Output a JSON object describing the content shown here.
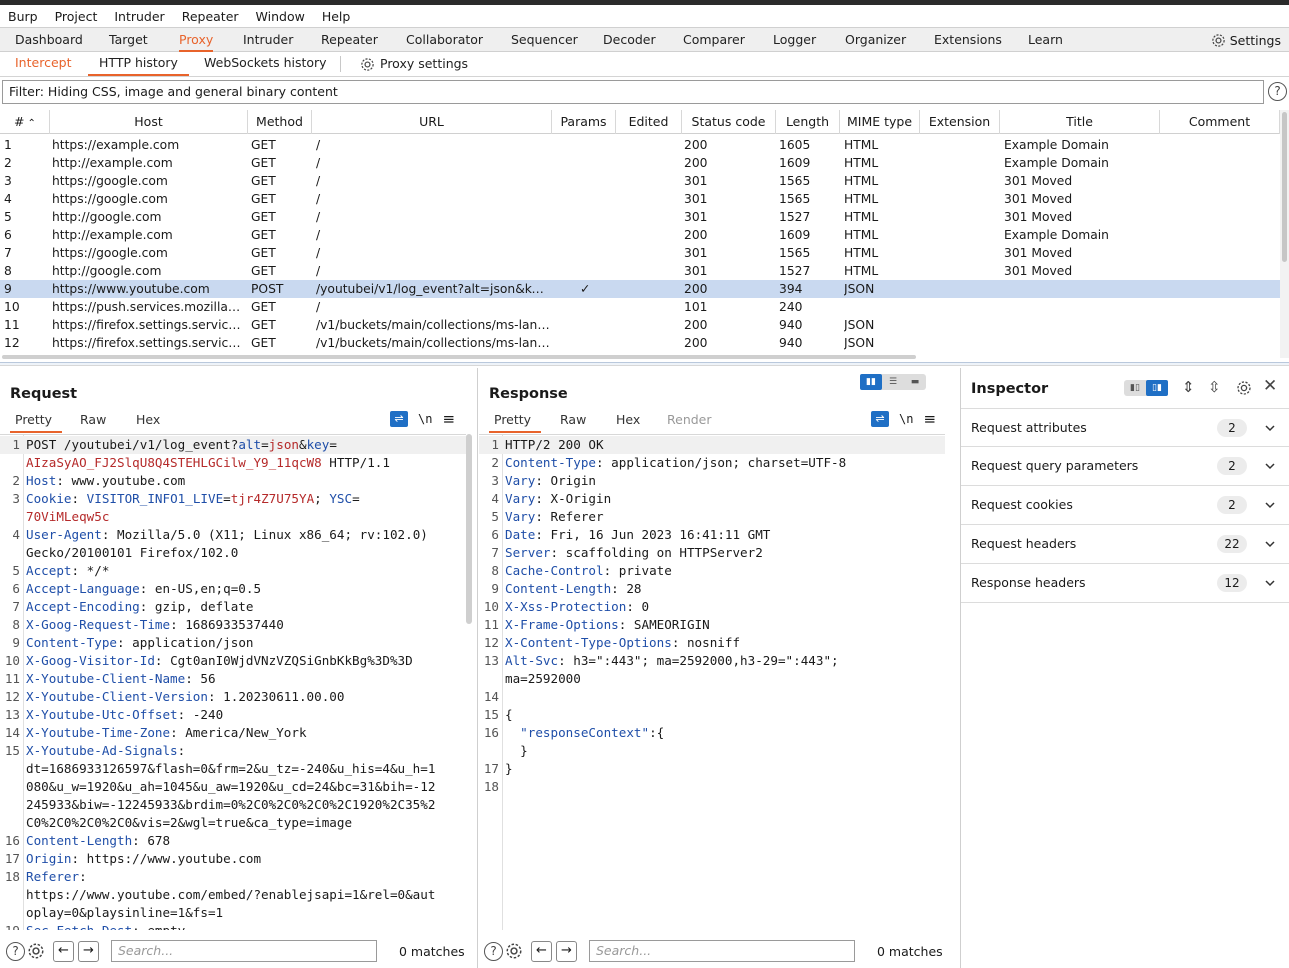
{
  "menu": [
    "Burp",
    "Project",
    "Intruder",
    "Repeater",
    "Window",
    "Help"
  ],
  "main_tabs": [
    "Dashboard",
    "Target",
    "Proxy",
    "Intruder",
    "Repeater",
    "Collaborator",
    "Sequencer",
    "Decoder",
    "Comparer",
    "Logger",
    "Organizer",
    "Extensions",
    "Learn"
  ],
  "main_tab_active": "Proxy",
  "settings_label": "Settings",
  "sub_tabs": {
    "intercept": "Intercept",
    "http_history": "HTTP history",
    "websockets": "WebSockets history",
    "proxy_settings": "Proxy settings"
  },
  "filter_text": "Filter: Hiding CSS, image and general binary content",
  "help_glyph": "?",
  "columns": [
    "#",
    "Host",
    "Method",
    "URL",
    "Params",
    "Edited",
    "Status code",
    "Length",
    "MIME type",
    "Extension",
    "Title",
    "Comment"
  ],
  "sort_glyph": "⌃",
  "rows": [
    {
      "id": "1",
      "host": "https://example.com",
      "method": "GET",
      "url": "/",
      "params": "",
      "status": "200",
      "length": "1605",
      "mime": "HTML",
      "title": "Example Domain"
    },
    {
      "id": "2",
      "host": "http://example.com",
      "method": "GET",
      "url": "/",
      "params": "",
      "status": "200",
      "length": "1609",
      "mime": "HTML",
      "title": "Example Domain"
    },
    {
      "id": "3",
      "host": "https://google.com",
      "method": "GET",
      "url": "/",
      "params": "",
      "status": "301",
      "length": "1565",
      "mime": "HTML",
      "title": "301 Moved"
    },
    {
      "id": "4",
      "host": "https://google.com",
      "method": "GET",
      "url": "/",
      "params": "",
      "status": "301",
      "length": "1565",
      "mime": "HTML",
      "title": "301 Moved"
    },
    {
      "id": "5",
      "host": "http://google.com",
      "method": "GET",
      "url": "/",
      "params": "",
      "status": "301",
      "length": "1527",
      "mime": "HTML",
      "title": "301 Moved"
    },
    {
      "id": "6",
      "host": "http://example.com",
      "method": "GET",
      "url": "/",
      "params": "",
      "status": "200",
      "length": "1609",
      "mime": "HTML",
      "title": "Example Domain"
    },
    {
      "id": "7",
      "host": "https://google.com",
      "method": "GET",
      "url": "/",
      "params": "",
      "status": "301",
      "length": "1565",
      "mime": "HTML",
      "title": "301 Moved"
    },
    {
      "id": "8",
      "host": "http://google.com",
      "method": "GET",
      "url": "/",
      "params": "",
      "status": "301",
      "length": "1527",
      "mime": "HTML",
      "title": "301 Moved"
    },
    {
      "id": "9",
      "host": "https://www.youtube.com",
      "method": "POST",
      "url": "/youtubei/v1/log_event?alt=json&key=...",
      "params": "✓",
      "status": "200",
      "length": "394",
      "mime": "JSON",
      "title": ""
    },
    {
      "id": "10",
      "host": "https://push.services.mozilla.com",
      "method": "GET",
      "url": "/",
      "params": "",
      "status": "101",
      "length": "240",
      "mime": "",
      "title": ""
    },
    {
      "id": "11",
      "host": "https://firefox.settings.services....",
      "method": "GET",
      "url": "/v1/buckets/main/collections/ms-langu...",
      "params": "",
      "status": "200",
      "length": "940",
      "mime": "JSON",
      "title": ""
    },
    {
      "id": "12",
      "host": "https://firefox.settings.services....",
      "method": "GET",
      "url": "/v1/buckets/main/collections/ms-langu...",
      "params": "",
      "status": "200",
      "length": "940",
      "mime": "JSON",
      "title": ""
    }
  ],
  "selected_row": "9",
  "request": {
    "title": "Request",
    "tabs": [
      "Pretty",
      "Raw",
      "Hex"
    ],
    "newline_glyph": "\\n",
    "menu_glyph": "≡",
    "lines": [
      {
        "n": "1",
        "parts": [
          [
            "",
            "POST /youtubei/v1/log_event?"
          ],
          [
            "k",
            "alt"
          ],
          [
            "",
            "="
          ],
          [
            "v",
            "json"
          ],
          [
            "",
            "&"
          ],
          [
            "k",
            "key"
          ],
          [
            "",
            "="
          ]
        ]
      },
      {
        "n": "",
        "parts": [
          [
            "v",
            "AIzaSyAO_FJ2SlqU8Q4STEHLGCilw_Y9_11qcW8"
          ],
          [
            "",
            " HTTP/1.1"
          ]
        ]
      },
      {
        "n": "2",
        "parts": [
          [
            "k",
            "Host"
          ],
          [
            "",
            ": www.youtube.com"
          ]
        ]
      },
      {
        "n": "3",
        "parts": [
          [
            "k",
            "Cookie"
          ],
          [
            "",
            ": "
          ],
          [
            "k",
            "VISITOR_INFO1_LIVE"
          ],
          [
            "",
            "="
          ],
          [
            "v",
            "tjr4Z7U75YA"
          ],
          [
            "",
            "; "
          ],
          [
            "k",
            "YSC"
          ],
          [
            "",
            "="
          ]
        ]
      },
      {
        "n": "",
        "parts": [
          [
            "v",
            "70ViMLeqw5c"
          ]
        ]
      },
      {
        "n": "4",
        "parts": [
          [
            "k",
            "User-Agent"
          ],
          [
            "",
            ": Mozilla/5.0 (X11; Linux x86_64; rv:102.0)"
          ]
        ]
      },
      {
        "n": "",
        "parts": [
          [
            "",
            "Gecko/20100101 Firefox/102.0"
          ]
        ]
      },
      {
        "n": "5",
        "parts": [
          [
            "k",
            "Accept"
          ],
          [
            "",
            ": */*"
          ]
        ]
      },
      {
        "n": "6",
        "parts": [
          [
            "k",
            "Accept-Language"
          ],
          [
            "",
            ": en-US,en;q=0.5"
          ]
        ]
      },
      {
        "n": "7",
        "parts": [
          [
            "k",
            "Accept-Encoding"
          ],
          [
            "",
            ": gzip, deflate"
          ]
        ]
      },
      {
        "n": "8",
        "parts": [
          [
            "k",
            "X-Goog-Request-Time"
          ],
          [
            "",
            ": 1686933537440"
          ]
        ]
      },
      {
        "n": "9",
        "parts": [
          [
            "k",
            "Content-Type"
          ],
          [
            "",
            ": application/json"
          ]
        ]
      },
      {
        "n": "10",
        "parts": [
          [
            "k",
            "X-Goog-Visitor-Id"
          ],
          [
            "",
            ": Cgt0anI0WjdVNzVZQSiGnbKkBg%3D%3D"
          ]
        ]
      },
      {
        "n": "11",
        "parts": [
          [
            "k",
            "X-Youtube-Client-Name"
          ],
          [
            "",
            ": 56"
          ]
        ]
      },
      {
        "n": "12",
        "parts": [
          [
            "k",
            "X-Youtube-Client-Version"
          ],
          [
            "",
            ": 1.20230611.00.00"
          ]
        ]
      },
      {
        "n": "13",
        "parts": [
          [
            "k",
            "X-Youtube-Utc-Offset"
          ],
          [
            "",
            ": -240"
          ]
        ]
      },
      {
        "n": "14",
        "parts": [
          [
            "k",
            "X-Youtube-Time-Zone"
          ],
          [
            "",
            ": America/New_York"
          ]
        ]
      },
      {
        "n": "15",
        "parts": [
          [
            "k",
            "X-Youtube-Ad-Signals"
          ],
          [
            "",
            ":"
          ]
        ]
      },
      {
        "n": "",
        "parts": [
          [
            "",
            "dt=1686933126597&flash=0&frm=2&u_tz=-240&u_his=4&u_h=1"
          ]
        ]
      },
      {
        "n": "",
        "parts": [
          [
            "",
            "080&u_w=1920&u_ah=1045&u_aw=1920&u_cd=24&bc=31&bih=-12"
          ]
        ]
      },
      {
        "n": "",
        "parts": [
          [
            "",
            "245933&biw=-12245933&brdim=0%2C0%2C0%2C0%2C1920%2C35%2"
          ]
        ]
      },
      {
        "n": "",
        "parts": [
          [
            "",
            "C0%2C0%2C0%2C0&vis=2&wgl=true&ca_type=image"
          ]
        ]
      },
      {
        "n": "16",
        "parts": [
          [
            "k",
            "Content-Length"
          ],
          [
            "",
            ": 678"
          ]
        ]
      },
      {
        "n": "17",
        "parts": [
          [
            "k",
            "Origin"
          ],
          [
            "",
            ": https://www.youtube.com"
          ]
        ]
      },
      {
        "n": "18",
        "parts": [
          [
            "k",
            "Referer"
          ],
          [
            "",
            ":"
          ]
        ]
      },
      {
        "n": "",
        "parts": [
          [
            "",
            "https://www.youtube.com/embed/?enablejsapi=1&rel=0&aut"
          ]
        ]
      },
      {
        "n": "",
        "parts": [
          [
            "",
            "oplay=0&playsinline=1&fs=1"
          ]
        ]
      },
      {
        "n": "19",
        "parts": [
          [
            "k",
            "Sec-Fetch-Dest"
          ],
          [
            "",
            ": empty"
          ]
        ]
      }
    ],
    "search_placeholder": "Search...",
    "matches": "0 matches"
  },
  "response": {
    "title": "Response",
    "tabs": [
      "Pretty",
      "Raw",
      "Hex",
      "Render"
    ],
    "newline_glyph": "\\n",
    "menu_glyph": "≡",
    "lines": [
      {
        "n": "1",
        "parts": [
          [
            "",
            "HTTP/2 200 OK"
          ]
        ]
      },
      {
        "n": "2",
        "parts": [
          [
            "k",
            "Content-Type"
          ],
          [
            "",
            ": application/json; charset=UTF-8"
          ]
        ]
      },
      {
        "n": "3",
        "parts": [
          [
            "k",
            "Vary"
          ],
          [
            "",
            ": Origin"
          ]
        ]
      },
      {
        "n": "4",
        "parts": [
          [
            "k",
            "Vary"
          ],
          [
            "",
            ": X-Origin"
          ]
        ]
      },
      {
        "n": "5",
        "parts": [
          [
            "k",
            "Vary"
          ],
          [
            "",
            ": Referer"
          ]
        ]
      },
      {
        "n": "6",
        "parts": [
          [
            "k",
            "Date"
          ],
          [
            "",
            ": Fri, 16 Jun 2023 16:41:11 GMT"
          ]
        ]
      },
      {
        "n": "7",
        "parts": [
          [
            "k",
            "Server"
          ],
          [
            "",
            ": scaffolding on HTTPServer2"
          ]
        ]
      },
      {
        "n": "8",
        "parts": [
          [
            "k",
            "Cache-Control"
          ],
          [
            "",
            ": private"
          ]
        ]
      },
      {
        "n": "9",
        "parts": [
          [
            "k",
            "Content-Length"
          ],
          [
            "",
            ": 28"
          ]
        ]
      },
      {
        "n": "10",
        "parts": [
          [
            "k",
            "X-Xss-Protection"
          ],
          [
            "",
            ": 0"
          ]
        ]
      },
      {
        "n": "11",
        "parts": [
          [
            "k",
            "X-Frame-Options"
          ],
          [
            "",
            ": SAMEORIGIN"
          ]
        ]
      },
      {
        "n": "12",
        "parts": [
          [
            "k",
            "X-Content-Type-Options"
          ],
          [
            "",
            ": nosniff"
          ]
        ]
      },
      {
        "n": "13",
        "parts": [
          [
            "k",
            "Alt-Svc"
          ],
          [
            "",
            ": h3=\":443\"; ma=2592000,h3-29=\":443\";"
          ]
        ]
      },
      {
        "n": "",
        "parts": [
          [
            "",
            "ma=2592000"
          ]
        ]
      },
      {
        "n": "14",
        "parts": [
          [
            "",
            ""
          ]
        ]
      },
      {
        "n": "15",
        "parts": [
          [
            "",
            "{"
          ]
        ]
      },
      {
        "n": "16",
        "parts": [
          [
            "",
            "  "
          ],
          [
            "k",
            "\"responseContext\""
          ],
          [
            "",
            ":{"
          ]
        ]
      },
      {
        "n": "",
        "parts": [
          [
            "",
            "  }"
          ]
        ]
      },
      {
        "n": "17",
        "parts": [
          [
            "",
            "}"
          ]
        ]
      },
      {
        "n": "18",
        "parts": [
          [
            "",
            ""
          ]
        ]
      }
    ],
    "search_placeholder": "Search...",
    "matches": "0 matches"
  },
  "inspector": {
    "title": "Inspector",
    "sections": [
      {
        "label": "Request attributes",
        "count": "2"
      },
      {
        "label": "Request query parameters",
        "count": "2"
      },
      {
        "label": "Request cookies",
        "count": "2"
      },
      {
        "label": "Request headers",
        "count": "22"
      },
      {
        "label": "Response headers",
        "count": "12"
      }
    ]
  },
  "colors": {
    "accent": "#e8632b",
    "key": "#1f4ea8",
    "value": "#b52a2a",
    "selected_row": "#c9d9f0",
    "button_blue": "#1f6fc5"
  }
}
